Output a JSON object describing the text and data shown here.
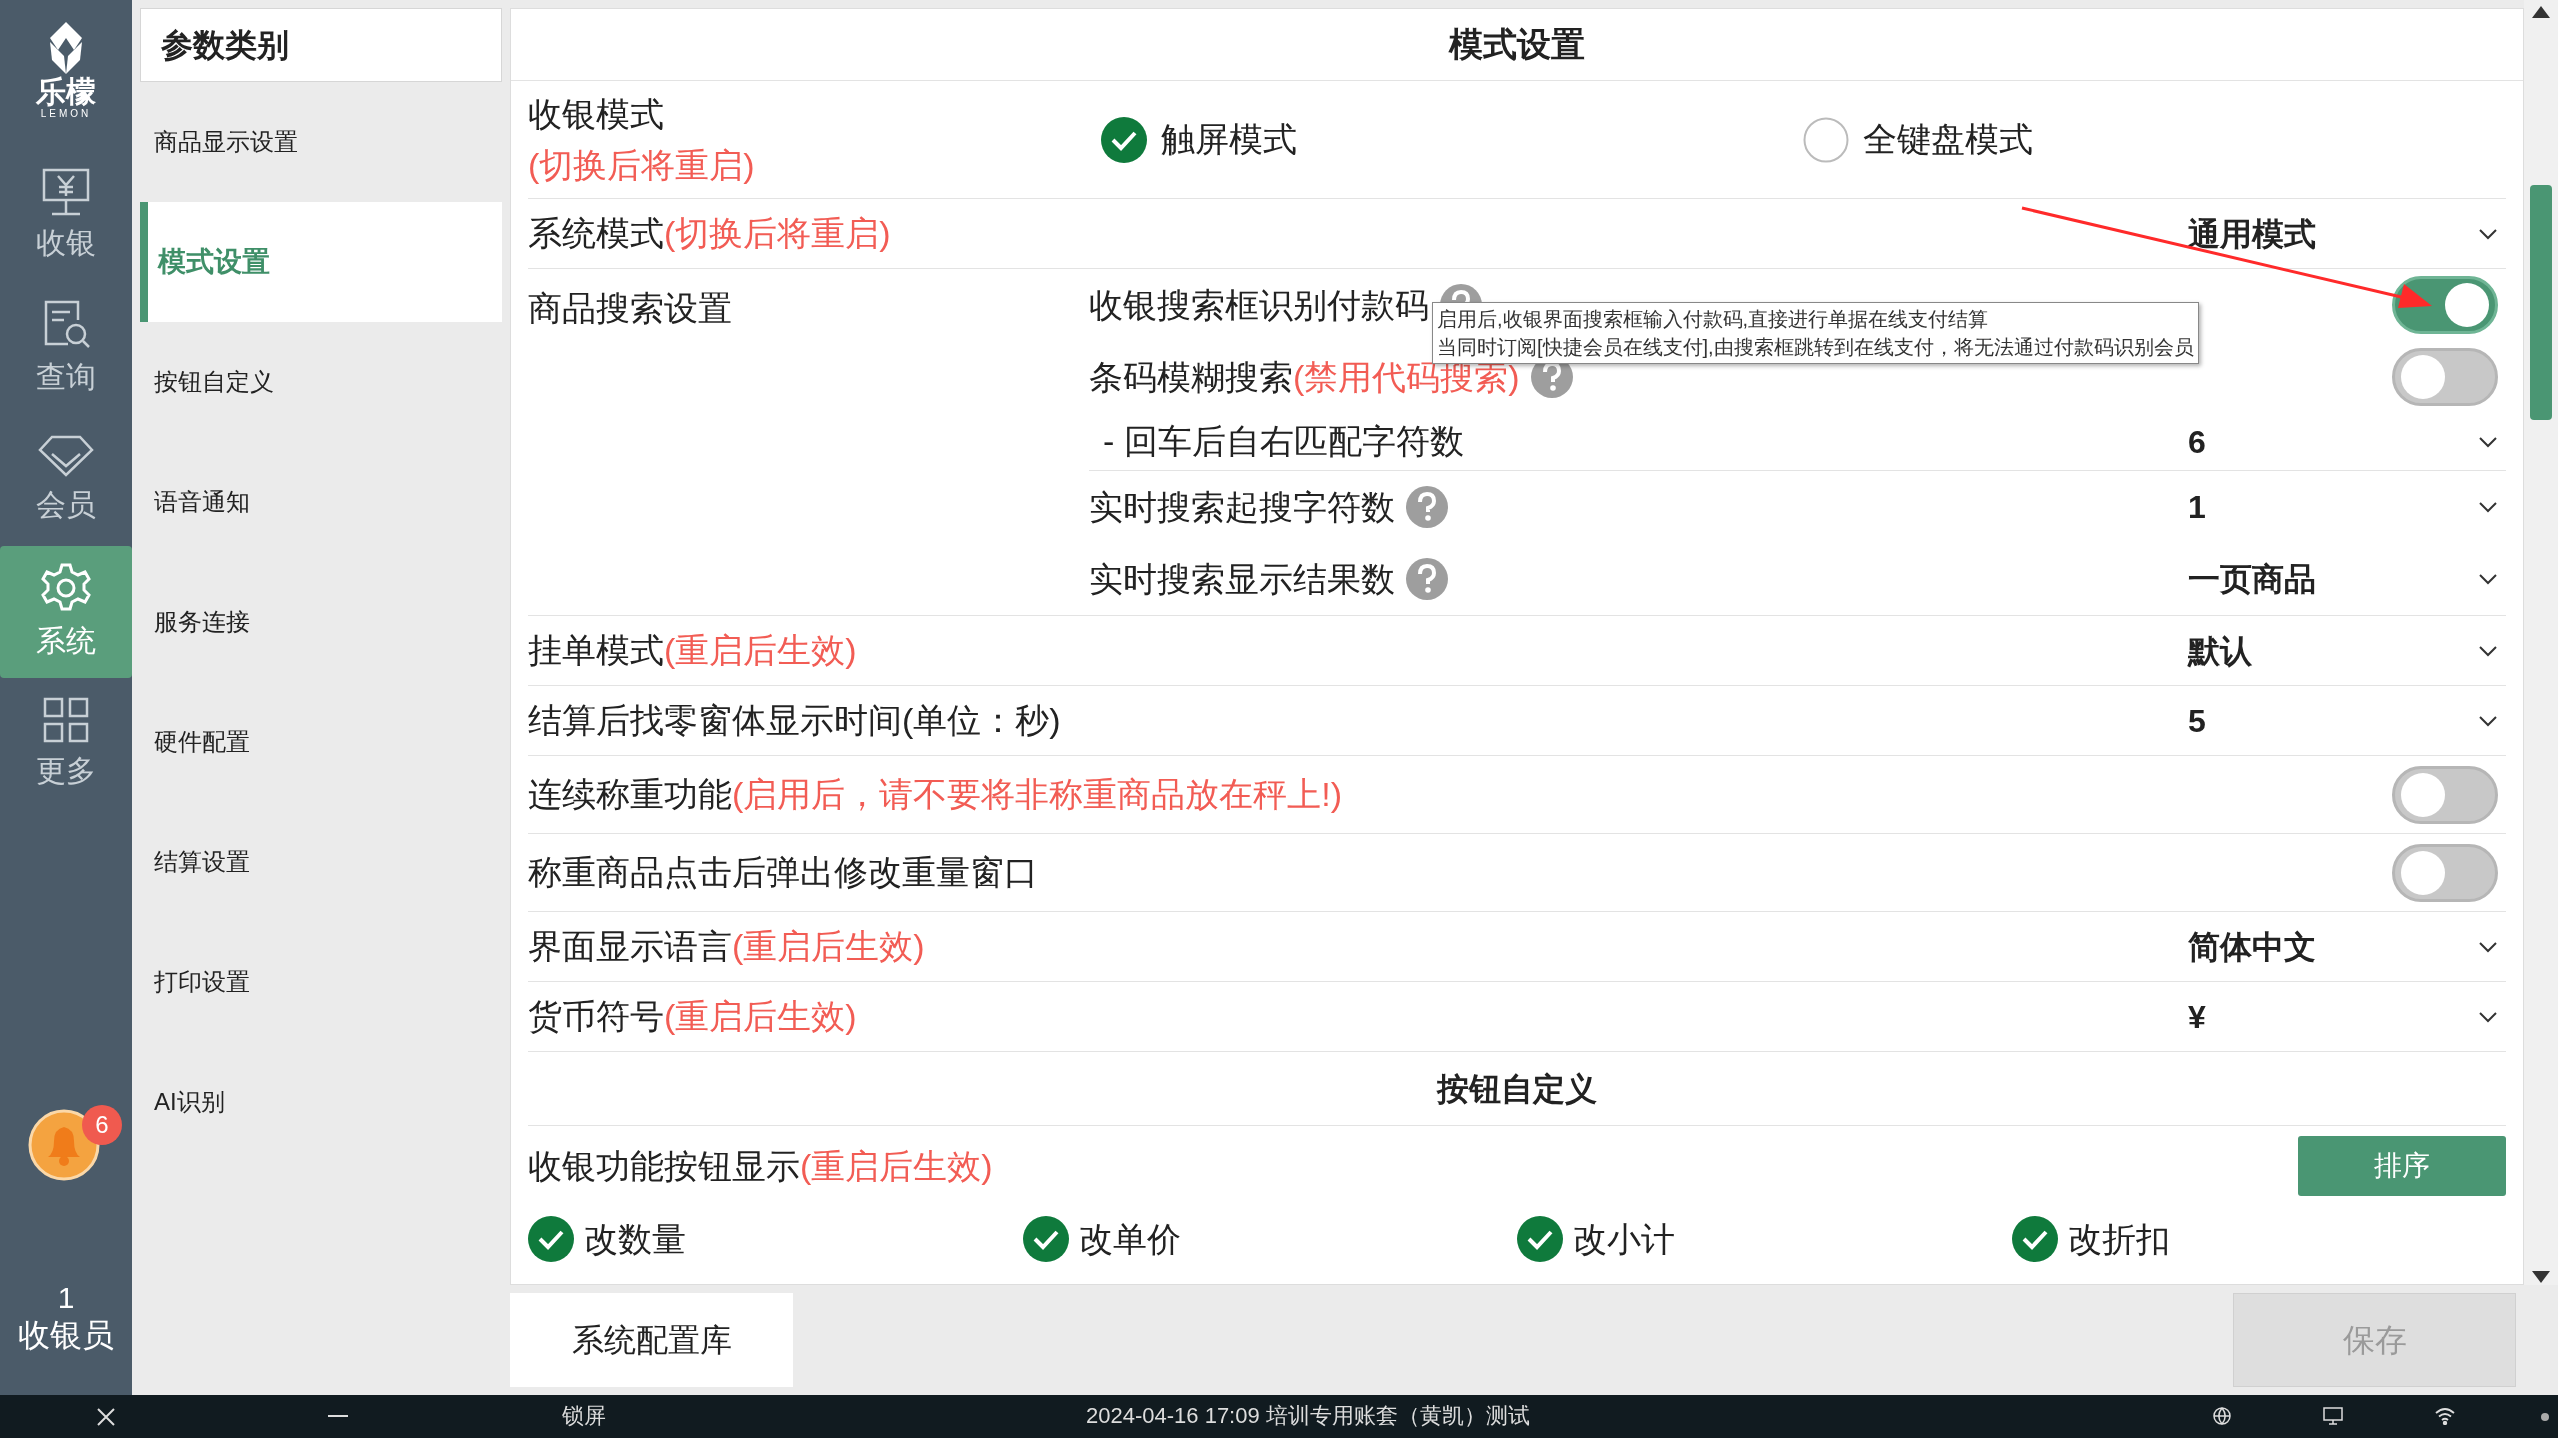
{
  "nav": {
    "logo_text": "乐檬",
    "logo_sub": "LEMON",
    "items": [
      {
        "label": "收银",
        "selected": false
      },
      {
        "label": "查询",
        "selected": false
      },
      {
        "label": "会员",
        "selected": false
      },
      {
        "label": "系统",
        "selected": true
      },
      {
        "label": "更多",
        "selected": false
      }
    ],
    "notification_count": "6",
    "user_count": "1",
    "user_role": "收银员"
  },
  "categories": {
    "title": "参数类别",
    "items": [
      {
        "label": "商品显示设置",
        "selected": false
      },
      {
        "label": "模式设置",
        "selected": true
      },
      {
        "label": "按钮自定义",
        "selected": false
      },
      {
        "label": "语音通知",
        "selected": false
      },
      {
        "label": "服务连接",
        "selected": false
      },
      {
        "label": "硬件配置",
        "selected": false
      },
      {
        "label": "结算设置",
        "selected": false
      },
      {
        "label": "打印设置",
        "selected": false
      },
      {
        "label": "AI识别",
        "selected": false
      }
    ]
  },
  "panel": {
    "title": "模式设置",
    "rows": [
      {
        "kind": "radio",
        "label": "收银模式",
        "note": "(切换后将重启)",
        "options": [
          {
            "label": "触屏模式",
            "selected": true
          },
          {
            "label": "全键盘模式",
            "selected": false
          }
        ]
      },
      {
        "kind": "select",
        "label": "系统模式",
        "note": "(切换后将重启)",
        "value": "通用模式"
      },
      {
        "kind": "group",
        "label": "商品搜索设置",
        "children": [
          {
            "kind": "toggle",
            "label": "收银搜索框识别付款码",
            "help": true,
            "on": true
          },
          {
            "kind": "toggle",
            "label": "条码模糊搜索",
            "note": "(禁用代码搜索)",
            "help": true,
            "on": false
          },
          {
            "kind": "select",
            "label": "- 回车后自右匹配字符数",
            "value": "6"
          },
          {
            "kind": "select",
            "label": "实时搜索起搜字符数",
            "help": true,
            "value": "1"
          },
          {
            "kind": "select",
            "label": "实时搜索显示结果数",
            "help": true,
            "value": "一页商品"
          }
        ]
      },
      {
        "kind": "select",
        "label": "挂单模式",
        "note": "(重启后生效)",
        "value": "默认"
      },
      {
        "kind": "select",
        "label": "结算后找零窗体显示时间(单位：秒)",
        "value": "5"
      },
      {
        "kind": "toggle",
        "label": "连续称重功能",
        "note": "(启用后，请不要将非称重商品放在秤上!)",
        "on": false
      },
      {
        "kind": "toggle",
        "label": "称重商品点击后弹出修改重量窗口",
        "on": false
      },
      {
        "kind": "select",
        "label": "界面显示语言",
        "note": "(重启后生效)",
        "value": "简体中文"
      },
      {
        "kind": "select",
        "label": "货币符号",
        "note": "(重启后生效)",
        "value": "¥"
      },
      {
        "kind": "section",
        "label": "按钮自定义"
      },
      {
        "kind": "checks",
        "label": "收银功能按钮显示",
        "note": "(重启后生效)",
        "button": "排序",
        "items": [
          {
            "label": "改数量",
            "checked": true
          },
          {
            "label": "改单价",
            "checked": true
          },
          {
            "label": "改小计",
            "checked": true
          },
          {
            "label": "改折扣",
            "checked": true
          }
        ]
      }
    ]
  },
  "tooltip": {
    "lines": [
      "启用后,收银界面搜索框输入付款码,直接进行单据在线支付结算",
      "当同时订阅[快捷会员在线支付],由搜索框跳转到在线支付，将无法通过付款码识别会员"
    ]
  },
  "footer": {
    "config_button": "系统配置库",
    "save_button": {
      "label": "保存",
      "disabled": true
    }
  },
  "taskbar": {
    "lock": "锁屏",
    "status": "2024-04-16 17:09 培训专用账套（黄凯）测试"
  }
}
